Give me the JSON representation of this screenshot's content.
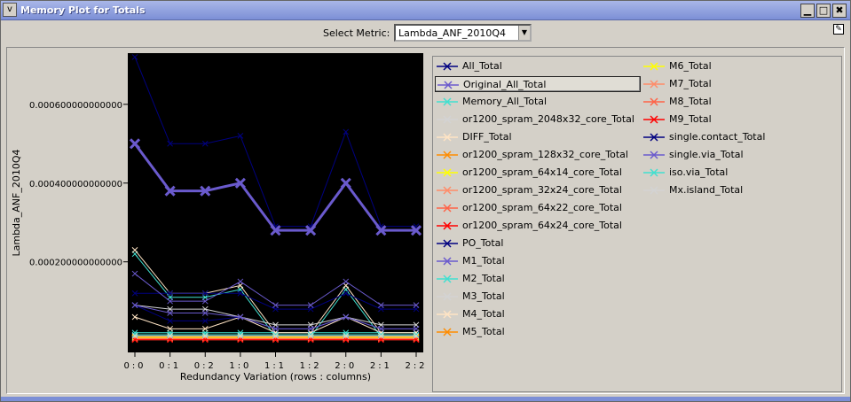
{
  "window": {
    "title": "Memory Plot for Totals",
    "menu_glyph": "v",
    "minimize_glyph": "▁",
    "maximize_glyph": "□",
    "close_glyph": "✖"
  },
  "metric": {
    "label": "Select Metric:",
    "selected": "Lambda_ANF_2010Q4"
  },
  "chart_data": {
    "type": "line",
    "xlabel": "Redundancy Variation (rows : columns)",
    "ylabel": "Lambda_ANF_2010Q4",
    "x_ticks": [
      "0:0",
      "0:1",
      "0:2",
      "1:0",
      "1:1",
      "1:2",
      "2:0",
      "2:1",
      "2:2"
    ],
    "y_ticks": [
      0.0002,
      0.0004,
      0.0006
    ],
    "y_tick_labels": [
      "0.000200000000000",
      "0.000400000000000",
      "0.000600000000000"
    ],
    "ylim": [
      -3e-05,
      0.00073
    ],
    "background": "#000000",
    "series": [
      {
        "name": "All_Total",
        "color": "#000080",
        "values": [
          0.00072,
          0.0005,
          0.0005,
          0.00052,
          0.00029,
          0.00029,
          0.00053,
          0.00029,
          0.00029
        ]
      },
      {
        "name": "Original_All_Total",
        "color": "#6a5acd",
        "values": [
          0.0005,
          0.00038,
          0.00038,
          0.0004,
          0.00028,
          0.00028,
          0.0004,
          0.00028,
          0.00028
        ],
        "emphasis": true
      },
      {
        "name": "Memory_All_Total",
        "color": "#40e0d0",
        "values": [
          0.00022,
          0.00011,
          0.00011,
          0.00013,
          1e-05,
          1e-05,
          0.00013,
          1e-05,
          1e-05
        ]
      },
      {
        "name": "or1200_spram_2048x32_core_Total",
        "color": "#d3d3d3",
        "values": [
          7.5e-06,
          7.5e-06,
          7.5e-06,
          7.5e-06,
          7.5e-06,
          7.5e-06,
          7.5e-06,
          7.5e-06,
          7.5e-06
        ]
      },
      {
        "name": "DIFF_Total",
        "color": "#ffe4c4",
        "values": [
          0.00023,
          0.00012,
          0.00012,
          0.00014,
          2e-05,
          2e-05,
          0.00014,
          2e-05,
          2e-05
        ]
      },
      {
        "name": "or1200_spram_128x32_core_Total",
        "color": "#ff8c00",
        "values": [
          5e-06,
          5e-06,
          5e-06,
          5e-06,
          5e-06,
          5e-06,
          5e-06,
          5e-06,
          5e-06
        ]
      },
      {
        "name": "or1200_spram_64x14_core_Total",
        "color": "#ffff00",
        "values": [
          3e-06,
          3e-06,
          3e-06,
          3e-06,
          3e-06,
          3e-06,
          3e-06,
          3e-06,
          3e-06
        ]
      },
      {
        "name": "or1200_spram_32x24_core_Total",
        "color": "#ff8c69",
        "values": [
          2e-06,
          2e-06,
          2e-06,
          2e-06,
          2e-06,
          2e-06,
          2e-06,
          2e-06,
          2e-06
        ]
      },
      {
        "name": "or1200_spram_64x22_core_Total",
        "color": "#ff6347",
        "values": [
          2.5e-06,
          2.5e-06,
          2.5e-06,
          2.5e-06,
          2.5e-06,
          2.5e-06,
          2.5e-06,
          2.5e-06,
          2.5e-06
        ]
      },
      {
        "name": "or1200_spram_64x24_core_Total",
        "color": "#ff0000",
        "values": [
          3e-06,
          3e-06,
          3e-06,
          3e-06,
          3e-06,
          3e-06,
          3e-06,
          3e-06,
          3e-06
        ]
      },
      {
        "name": "PO_Total",
        "color": "#000080",
        "values": [
          0.00012,
          0.00012,
          0.00012,
          0.00012,
          8e-05,
          8e-05,
          0.00012,
          8e-05,
          8e-05
        ]
      },
      {
        "name": "M1_Total",
        "color": "#6a5acd",
        "values": [
          0.00017,
          0.0001,
          0.0001,
          0.00015,
          9e-05,
          9e-05,
          0.00015,
          9e-05,
          9e-05
        ]
      },
      {
        "name": "M2_Total",
        "color": "#40e0d0",
        "values": [
          2e-05,
          2e-05,
          2e-05,
          2e-05,
          2e-05,
          2e-05,
          2e-05,
          2e-05,
          2e-05
        ]
      },
      {
        "name": "M3_Total",
        "color": "#d3d3d3",
        "values": [
          9e-05,
          8e-05,
          8e-05,
          6e-05,
          4e-05,
          4e-05,
          6e-05,
          4e-05,
          4e-05
        ]
      },
      {
        "name": "M4_Total",
        "color": "#ffe4c4",
        "values": [
          6e-05,
          3e-05,
          3e-05,
          6e-05,
          2e-05,
          2e-05,
          6e-05,
          2e-05,
          2e-05
        ]
      },
      {
        "name": "M5_Total",
        "color": "#ff8c00",
        "values": [
          1e-05,
          1e-05,
          1e-05,
          1e-05,
          1e-05,
          1e-05,
          1e-05,
          1e-05,
          1e-05
        ]
      },
      {
        "name": "M6_Total",
        "color": "#ffff00",
        "values": [
          8e-06,
          8e-06,
          8e-06,
          8e-06,
          8e-06,
          8e-06,
          8e-06,
          8e-06,
          8e-06
        ]
      },
      {
        "name": "M7_Total",
        "color": "#ff8c69",
        "values": [
          6e-06,
          6e-06,
          6e-06,
          6e-06,
          6e-06,
          6e-06,
          6e-06,
          6e-06,
          6e-06
        ]
      },
      {
        "name": "M8_Total",
        "color": "#ff6347",
        "values": [
          4e-06,
          4e-06,
          4e-06,
          4e-06,
          4e-06,
          4e-06,
          4e-06,
          4e-06,
          4e-06
        ]
      },
      {
        "name": "M9_Total",
        "color": "#ff0000",
        "values": [
          2e-06,
          2e-06,
          2e-06,
          2e-06,
          2e-06,
          2e-06,
          2e-06,
          2e-06,
          2e-06
        ]
      },
      {
        "name": "single.contact_Total",
        "color": "#000080",
        "values": [
          9e-05,
          5e-05,
          5e-05,
          6e-05,
          3e-05,
          3e-05,
          6e-05,
          3e-05,
          3e-05
        ]
      },
      {
        "name": "single.via_Total",
        "color": "#6a5acd",
        "values": [
          9e-05,
          7e-05,
          7e-05,
          6e-05,
          3e-05,
          3e-05,
          6e-05,
          3e-05,
          3e-05
        ]
      },
      {
        "name": "iso.via_Total",
        "color": "#40e0d0",
        "values": [
          1.5e-05,
          1.5e-05,
          1.5e-05,
          1.5e-05,
          1.5e-05,
          1.5e-05,
          1.5e-05,
          1.5e-05,
          1.5e-05
        ]
      },
      {
        "name": "Mx.island_Total",
        "color": "#d3d3d3",
        "values": [
          1.2e-05,
          1.2e-05,
          1.2e-05,
          1.2e-05,
          1.2e-05,
          1.2e-05,
          1.2e-05,
          1.2e-05,
          1.2e-05
        ]
      }
    ],
    "legend_position": "right",
    "legend_selected": "Original_All_Total"
  }
}
